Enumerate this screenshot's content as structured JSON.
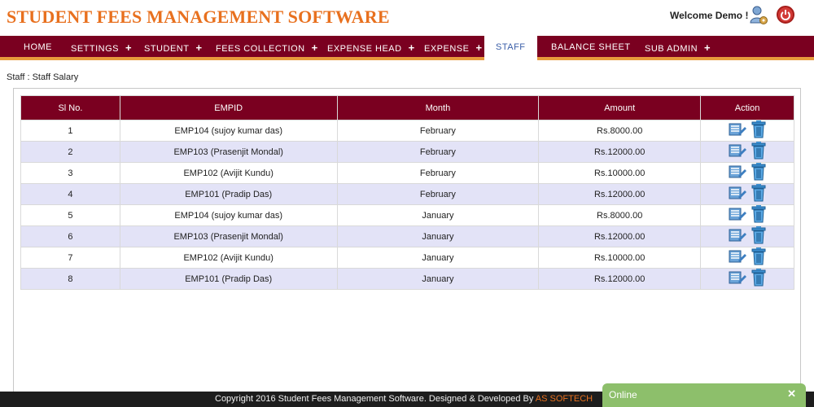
{
  "header": {
    "app_title": "STUDENT FEES MANAGEMENT SOFTWARE",
    "welcome": "Welcome Demo !"
  },
  "nav": {
    "items": [
      {
        "label": "HOME",
        "plus": ""
      },
      {
        "label": "SETTINGS",
        "plus": "+"
      },
      {
        "label": "STUDENT",
        "plus": "+"
      },
      {
        "label": "FEES COLLECTION",
        "plus": "+"
      },
      {
        "label": "EXPENSE HEAD",
        "plus": "+"
      },
      {
        "label": "EXPENSE",
        "plus": "+"
      },
      {
        "label": "STAFF",
        "plus": ""
      },
      {
        "label": "BALANCE SHEET",
        "plus": ""
      },
      {
        "label": "SUB ADMIN",
        "plus": "+"
      }
    ],
    "active": "STAFF"
  },
  "breadcrumb": "Staff : Staff Salary",
  "table": {
    "columns": [
      "Sl No.",
      "EMPID",
      "Month",
      "Amount",
      "Action"
    ],
    "rows": [
      {
        "sl": "1",
        "empid": "EMP104 (sujoy kumar das)",
        "month": "February",
        "amount": "Rs.8000.00"
      },
      {
        "sl": "2",
        "empid": "EMP103 (Prasenjit Mondal)",
        "month": "February",
        "amount": "Rs.12000.00"
      },
      {
        "sl": "3",
        "empid": "EMP102 (Avijit Kundu)",
        "month": "February",
        "amount": "Rs.10000.00"
      },
      {
        "sl": "4",
        "empid": "EMP101 (Pradip Das)",
        "month": "February",
        "amount": "Rs.12000.00"
      },
      {
        "sl": "5",
        "empid": "EMP104 (sujoy kumar das)",
        "month": "January",
        "amount": "Rs.8000.00"
      },
      {
        "sl": "6",
        "empid": "EMP103 (Prasenjit Mondal)",
        "month": "January",
        "amount": "Rs.12000.00"
      },
      {
        "sl": "7",
        "empid": "EMP102 (Avijit Kundu)",
        "month": "January",
        "amount": "Rs.10000.00"
      },
      {
        "sl": "8",
        "empid": "EMP101 (Pradip Das)",
        "month": "January",
        "amount": "Rs.12000.00"
      }
    ],
    "action_icons": [
      "edit-icon",
      "delete-icon"
    ]
  },
  "footer": {
    "text": "Copyright 2016 Student Fees Management Software. Designed & Developed By ",
    "link": "AS SOFTECH"
  },
  "chat": {
    "label": "Online",
    "close": "✕"
  },
  "colors": {
    "brand": "#e8701e",
    "nav_bg": "#7a0020",
    "nav_underline": "#e89a3c",
    "active_tab_text": "#3a5ea8",
    "row_alt": "#e3e3f7",
    "chat_bg": "#8dbf6b"
  }
}
